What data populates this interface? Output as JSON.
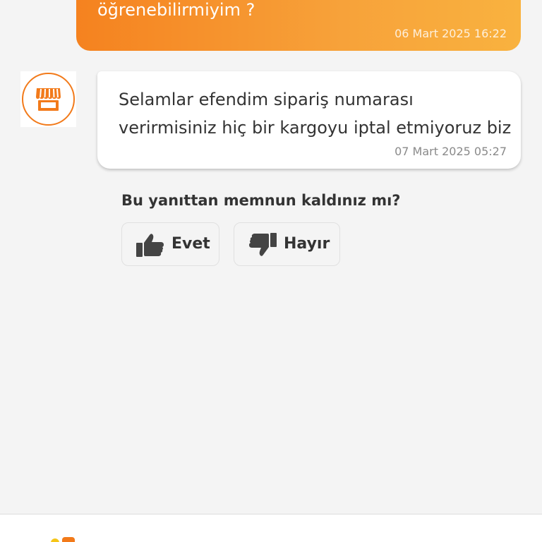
{
  "conversation": {
    "outgoing": {
      "text_visible": "öğrenebilirmiyim ?",
      "timestamp": "06 Mart 2025 16:22"
    },
    "incoming": {
      "avatar_icon": "store-icon",
      "text": "Selamlar efendim sipariş numarası verirmisiniz hiç bir kargoyu iptal etmiyoruz biz",
      "timestamp": "07 Mart 2025 05:27"
    }
  },
  "feedback": {
    "question": "Bu yanıttan memnun kaldınız mı?",
    "yes_label": "Evet",
    "no_label": "Hayır",
    "yes_icon": "thumbs-up-icon",
    "no_icon": "thumbs-down-icon"
  },
  "colors": {
    "brand_orange": "#f27a1a",
    "background": "#f4f4f4",
    "text_dark": "#333333"
  }
}
